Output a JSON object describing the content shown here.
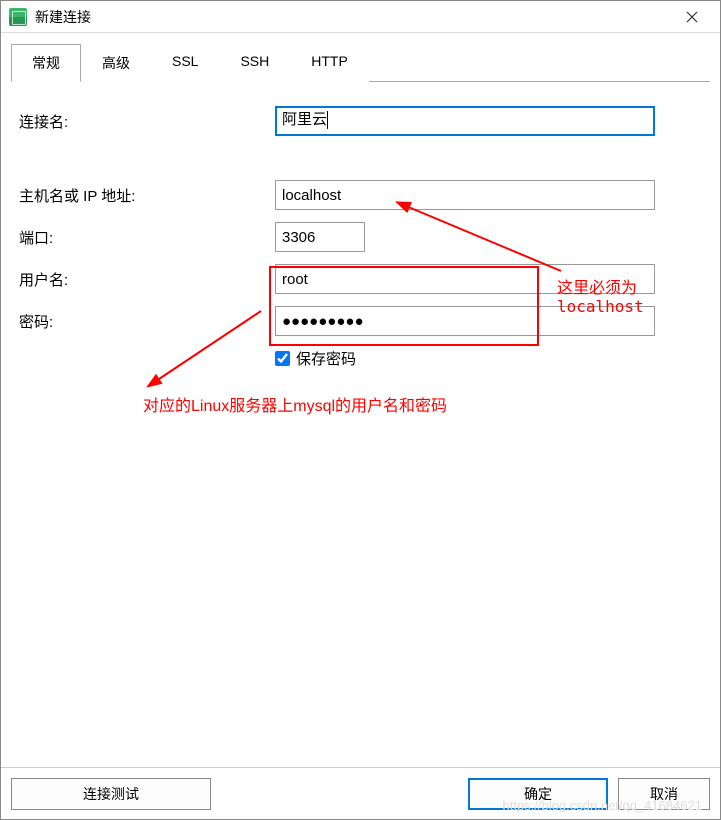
{
  "window": {
    "title": "新建连接"
  },
  "tabs": {
    "general": "常规",
    "advanced": "高级",
    "ssl": "SSL",
    "ssh": "SSH",
    "http": "HTTP"
  },
  "form": {
    "connection_name_label": "连接名:",
    "connection_name_value": "阿里云",
    "host_label": "主机名或 IP 地址:",
    "host_value": "localhost",
    "port_label": "端口:",
    "port_value": "3306",
    "username_label": "用户名:",
    "username_value": "root",
    "password_label": "密码:",
    "password_value": "●●●●●●●●●",
    "save_password_label": "保存密码"
  },
  "annotations": {
    "host_note_line1": "这里必须为",
    "host_note_line2": "localhost",
    "creds_note": "对应的Linux服务器上mysql的用户名和密码"
  },
  "footer": {
    "test": "连接测试",
    "ok": "确定",
    "cancel": "取消"
  },
  "watermark": "https://blog.csdn.net/qq_41684621"
}
